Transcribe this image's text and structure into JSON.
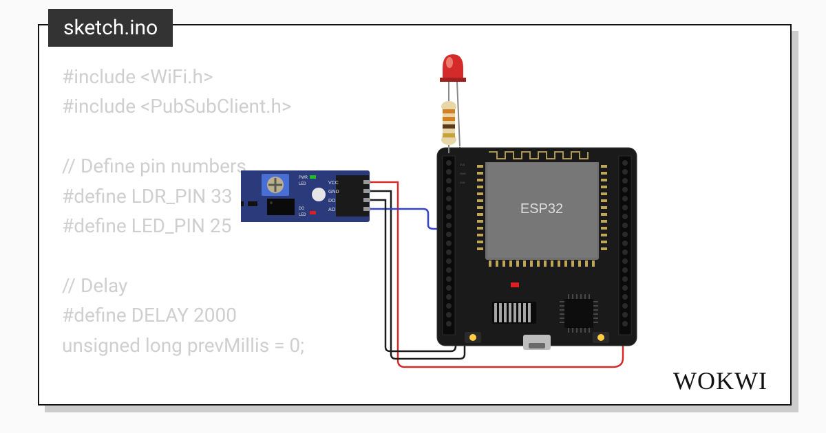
{
  "tab": {
    "filename": "sketch.ino"
  },
  "code": {
    "lines": [
      "#include <WiFi.h>",
      "#include <PubSubClient.h>",
      "",
      "// Define pin numbers",
      "#define LDR_PIN 33",
      "#define LED_PIN 25",
      "",
      "// Delay",
      "#define DELAY 2000",
      "unsigned long prevMillis = 0;"
    ]
  },
  "components": {
    "mcu": {
      "label": "ESP32"
    },
    "sensor": {
      "labels": [
        "VCC",
        "GND",
        "DO",
        "AO"
      ],
      "led_labels": [
        "PWR",
        "LED"
      ],
      "do_label": "DO",
      "led_label": "LED"
    },
    "led": {
      "color": "red"
    }
  },
  "brand": {
    "name": "WOKWI"
  },
  "colors": {
    "wire_red": "#d42a2a",
    "wire_black": "#1a1a1a",
    "wire_blue": "#3344cc",
    "wire_brown": "#8a5a2a",
    "pcb_blue": "#2a3a7a",
    "esp_black": "#1a1a1a",
    "esp_shield": "#6a6a6a"
  }
}
